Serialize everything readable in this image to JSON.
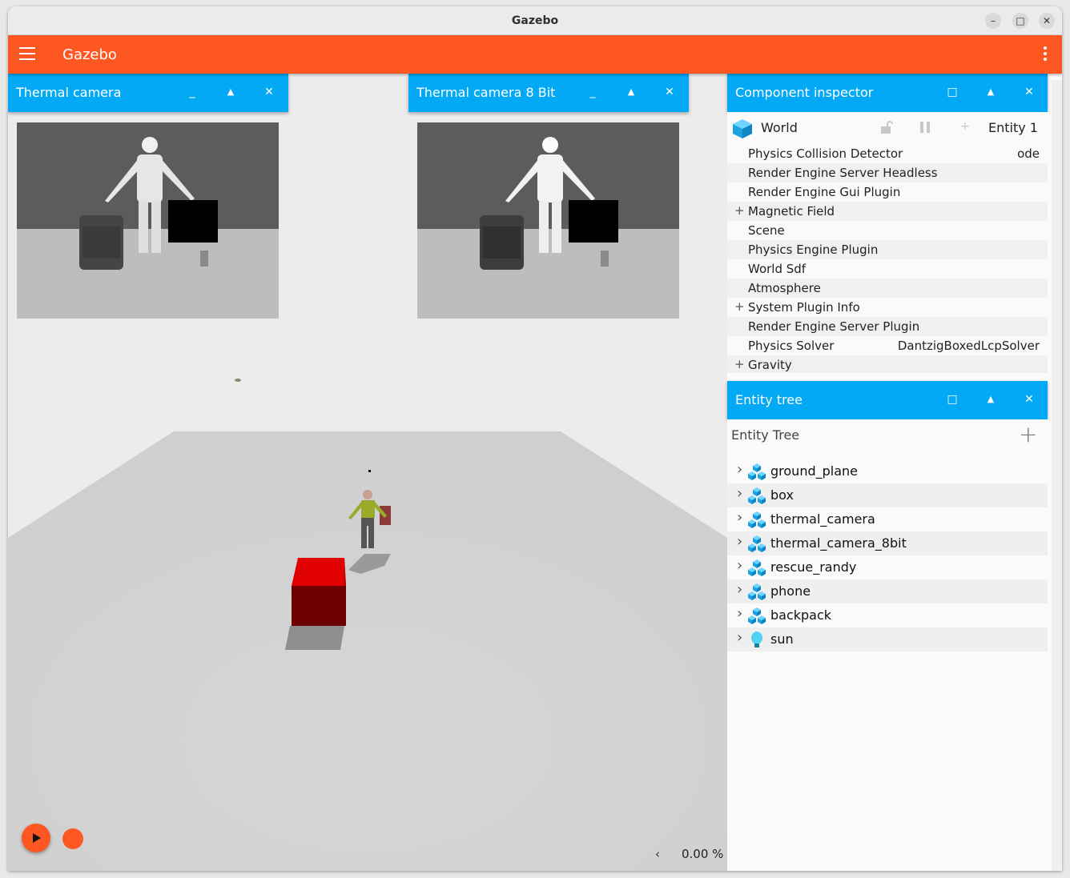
{
  "window": {
    "title": "Gazebo",
    "controls": [
      "–",
      "□",
      "✕"
    ]
  },
  "appbar": {
    "title": "Gazebo",
    "menu_icon": "hamburger-icon",
    "more_icon": "kebab-icon"
  },
  "panels": {
    "thermal": {
      "title": "Thermal camera",
      "min_label": "_",
      "up_label": "▲",
      "close_label": "✕"
    },
    "thermal8": {
      "title": "Thermal camera 8 Bit",
      "min_label": "_",
      "up_label": "▲",
      "close_label": "✕"
    },
    "inspector": {
      "title": "Component inspector",
      "max_label": "□",
      "up_label": "▲",
      "close_label": "✕"
    },
    "entity_tree": {
      "title": "Entity tree",
      "max_label": "□",
      "up_label": "▲",
      "close_label": "✕"
    }
  },
  "inspector": {
    "entity_name": "World",
    "entity_id": "Entity 1",
    "add_label": "+",
    "rows": [
      {
        "label": "Physics Collision Detector",
        "value": "ode",
        "expandable": false
      },
      {
        "label": "Render Engine Server Headless",
        "value": "",
        "expandable": false
      },
      {
        "label": "Render Engine Gui Plugin",
        "value": "",
        "expandable": false
      },
      {
        "label": "Magnetic Field",
        "value": "",
        "expandable": true
      },
      {
        "label": "Scene",
        "value": "",
        "expandable": false
      },
      {
        "label": "Physics Engine Plugin",
        "value": "",
        "expandable": false
      },
      {
        "label": "World Sdf",
        "value": "",
        "expandable": false
      },
      {
        "label": "Atmosphere",
        "value": "",
        "expandable": false
      },
      {
        "label": "System Plugin Info",
        "value": "",
        "expandable": true
      },
      {
        "label": "Render Engine Server Plugin",
        "value": "",
        "expandable": false
      },
      {
        "label": "Physics Solver",
        "value": "DantzigBoxedLcpSolver",
        "expandable": false
      },
      {
        "label": "Gravity",
        "value": "",
        "expandable": true
      }
    ]
  },
  "entity_tree": {
    "heading": "Entity Tree",
    "add_label": "+",
    "items": [
      {
        "name": "ground_plane",
        "icon": "model-icon"
      },
      {
        "name": "box",
        "icon": "model-icon"
      },
      {
        "name": "thermal_camera",
        "icon": "model-icon"
      },
      {
        "name": "thermal_camera_8bit",
        "icon": "model-icon"
      },
      {
        "name": "rescue_randy",
        "icon": "model-icon"
      },
      {
        "name": "phone",
        "icon": "model-icon"
      },
      {
        "name": "backpack",
        "icon": "model-icon"
      },
      {
        "name": "sun",
        "icon": "light-bulb-icon"
      }
    ]
  },
  "playback": {
    "rtf_value": "0.00 %",
    "expand_label": "‹"
  },
  "colors": {
    "appbar": "#ff5722",
    "panel_header": "#03a9f4",
    "box": "#e00000"
  }
}
